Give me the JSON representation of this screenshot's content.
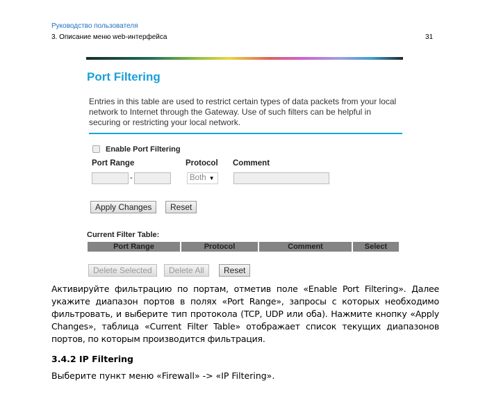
{
  "header": {
    "manual": "Руководство пользователя",
    "section": "3. Описание меню web-интерфейса",
    "page": "31"
  },
  "screenshot": {
    "title": "Port Filtering",
    "description": "Entries in this table are used to restrict certain types of data packets from your local network to Internet through the Gateway. Use of such filters can be helpful in securing or restricting your local network.",
    "enable_label": "Enable Port Filtering",
    "enable_checked": false,
    "port_range_label": "Port Range",
    "protocol_label": "Protocol",
    "comment_label": "Comment",
    "range_dash": "-",
    "port_from": "",
    "port_to": "",
    "comment": "",
    "protocol_value": "Both",
    "apply_label": "Apply Changes",
    "reset_label": "Reset",
    "table_title": "Current Filter Table:",
    "columns": [
      "Port Range",
      "Protocol",
      "Comment",
      "Select"
    ],
    "delete_selected_label": "Delete Selected",
    "delete_all_label": "Delete All",
    "reset2_label": "Reset",
    "accent": "#1a9fd9"
  },
  "body": {
    "paragraph": "Активируйте фильтрацию по портам, отметив поле «Enable Port Filtering». Далее укажите диапазон портов в полях «Port Range», запросы с которых необходимо фильтровать, и выберите тип протокола (TCP, UDP или оба). Нажмите кнопку «Apply Changes», таблица «Current Filter Table» отображает список текущих диапазонов портов, по которым производится фильтрация.",
    "heading": "3.4.2 IP Filtering",
    "instruction": "Выберите пункт меню «Firewall» -> «IP Filtering»."
  }
}
